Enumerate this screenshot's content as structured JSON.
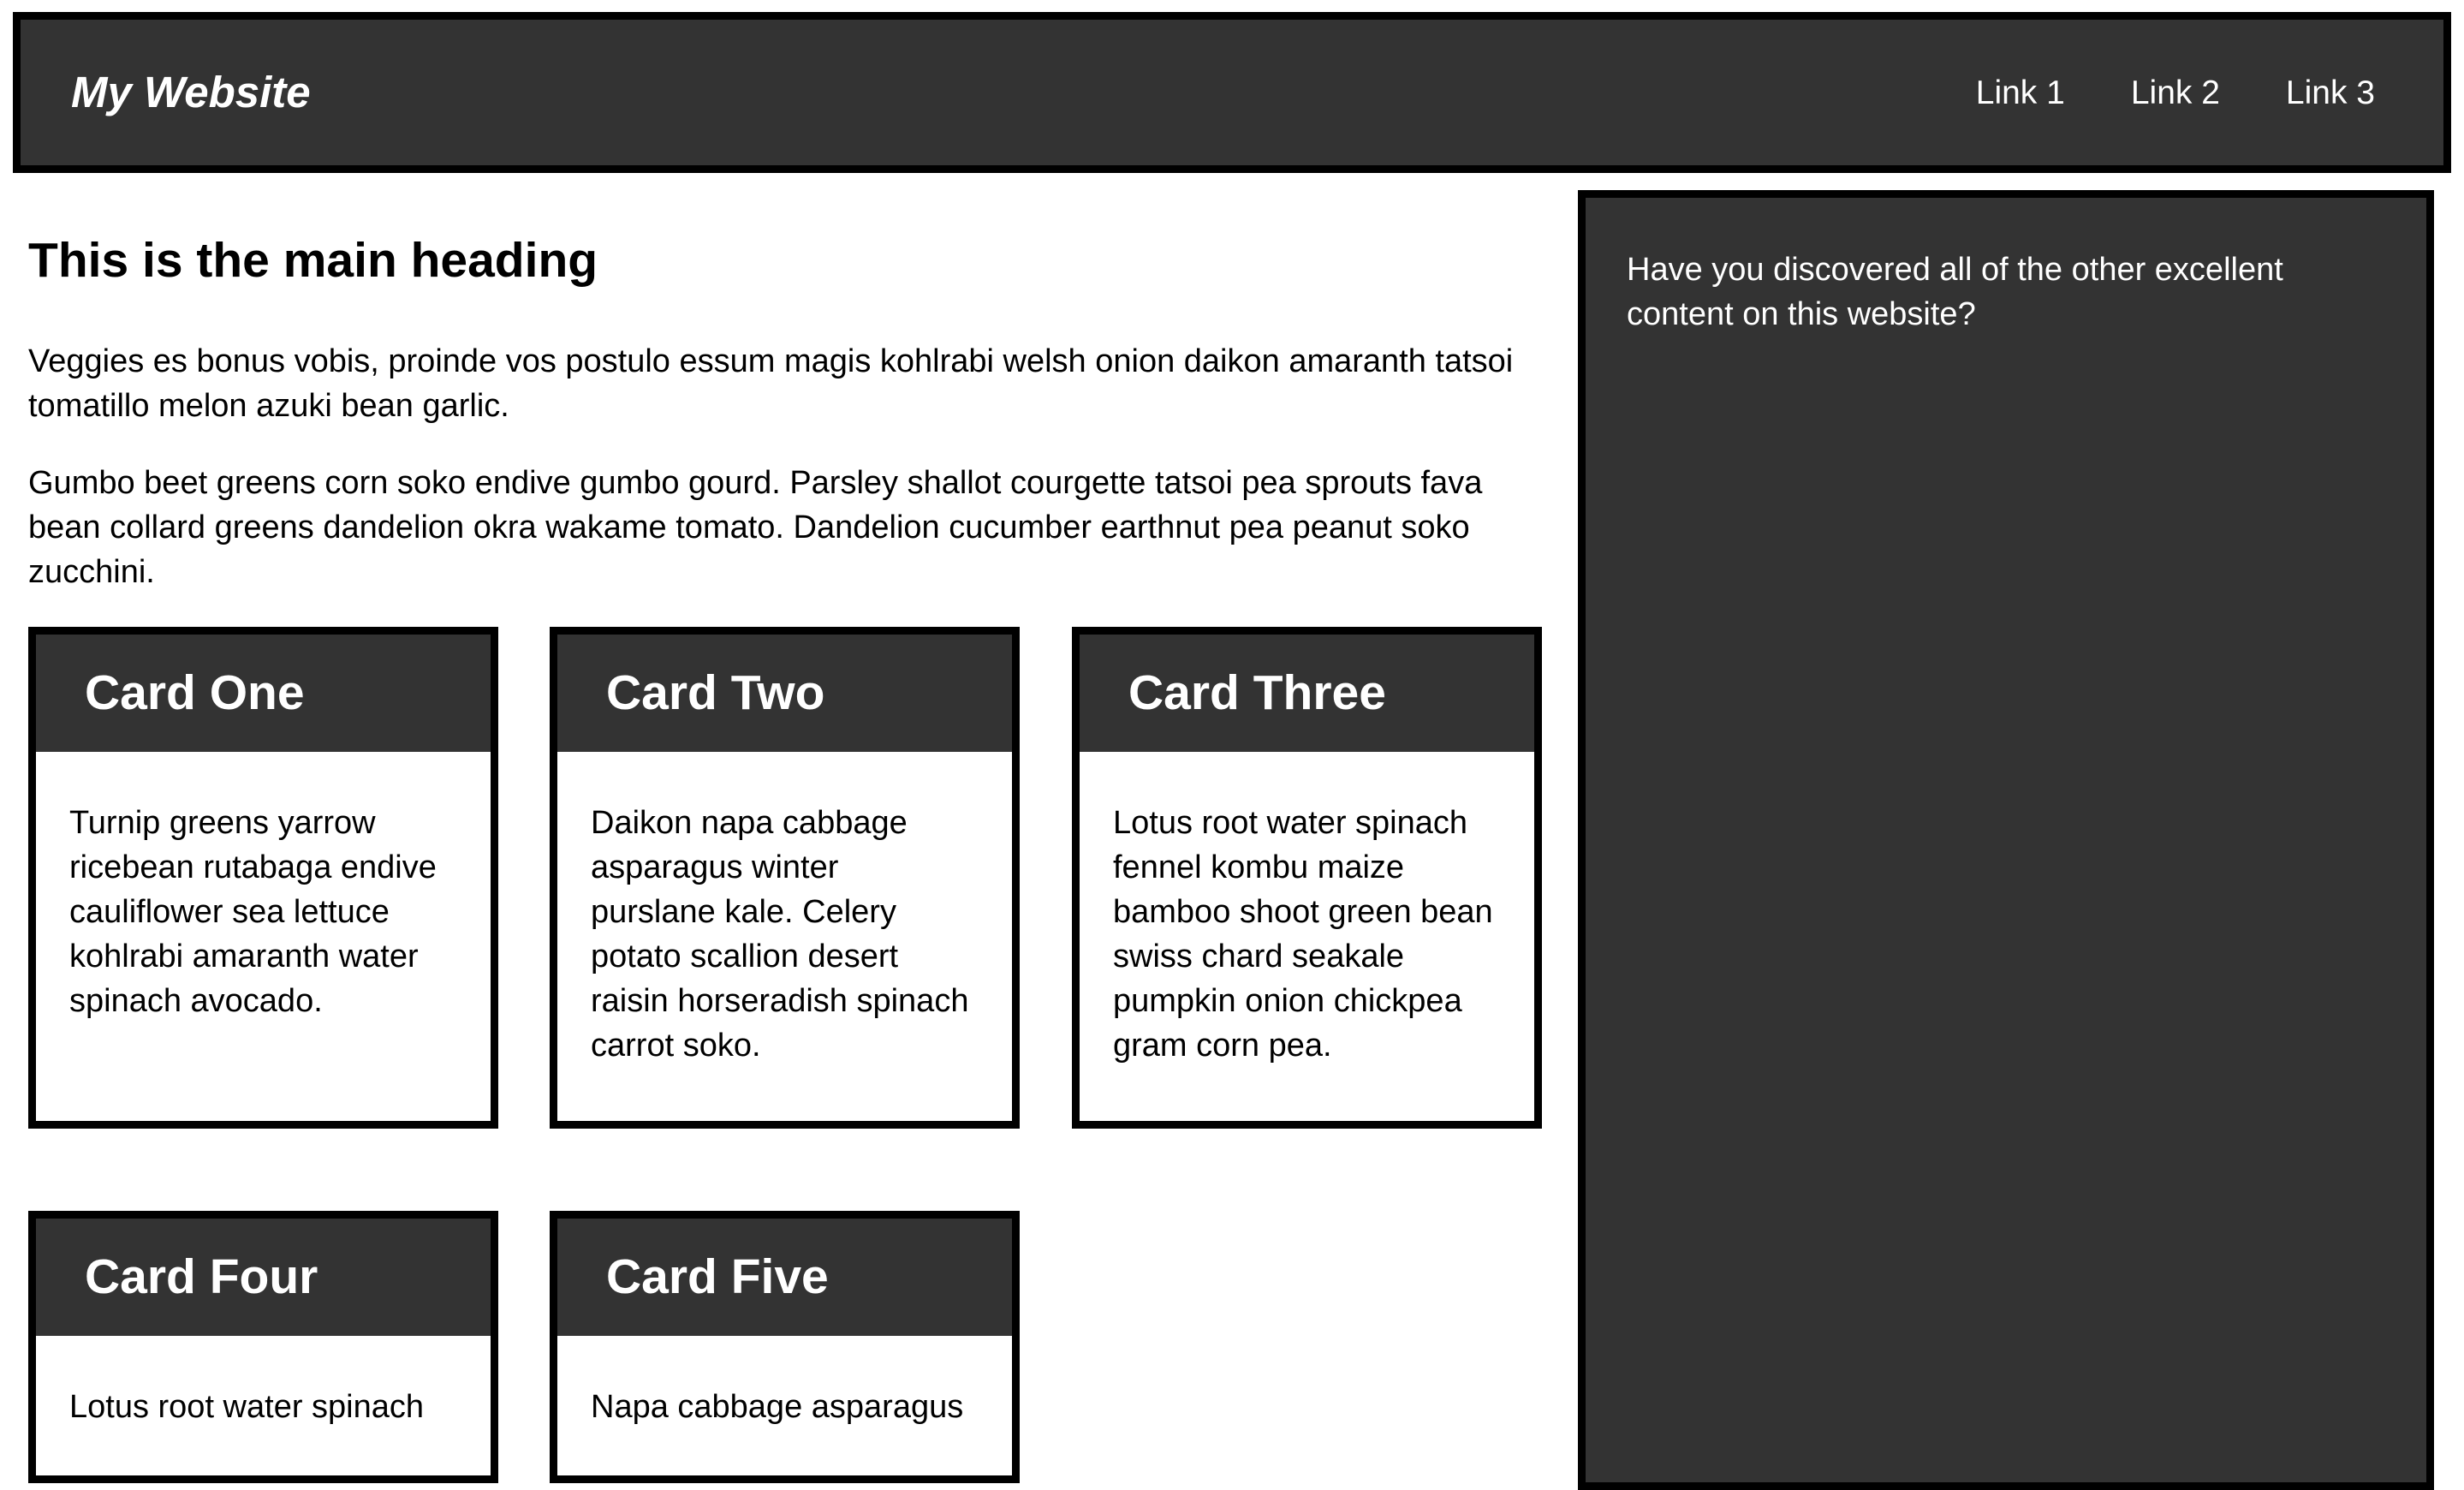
{
  "header": {
    "site_title": "My Website",
    "nav_links": [
      "Link 1",
      "Link 2",
      "Link 3"
    ]
  },
  "main": {
    "heading": "This is the main heading",
    "paragraphs": [
      "Veggies es bonus vobis, proinde vos postulo essum magis kohlrabi welsh onion daikon amaranth tatsoi tomatillo melon azuki bean garlic.",
      "Gumbo beet greens corn soko endive gumbo gourd. Parsley shallot courgette tatsoi pea sprouts fava bean collard greens dandelion okra wakame tomato. Dandelion cucumber earthnut pea peanut soko zucchini."
    ],
    "cards": [
      {
        "title": "Card One",
        "body": "Turnip greens yarrow ricebean rutabaga endive cauliflower sea lettuce kohlrabi amaranth water spinach avocado."
      },
      {
        "title": "Card Two",
        "body": "Daikon napa cabbage asparagus winter purslane kale. Celery potato scallion desert raisin horseradish spinach carrot soko."
      },
      {
        "title": "Card Three",
        "body": "Lotus root water spinach fennel kombu maize bamboo shoot green bean swiss chard seakale pumpkin onion chickpea gram corn pea."
      },
      {
        "title": "Card Four",
        "body": "Lotus root water spinach"
      },
      {
        "title": "Card Five",
        "body": "Napa cabbage asparagus"
      }
    ]
  },
  "sidebar": {
    "text": "Have you discovered all of the other excellent content on this website?"
  },
  "colors": {
    "header_bg": "#333333",
    "border": "#000000",
    "page_bg": "#ffffff",
    "inverse_text": "#ffffff"
  }
}
